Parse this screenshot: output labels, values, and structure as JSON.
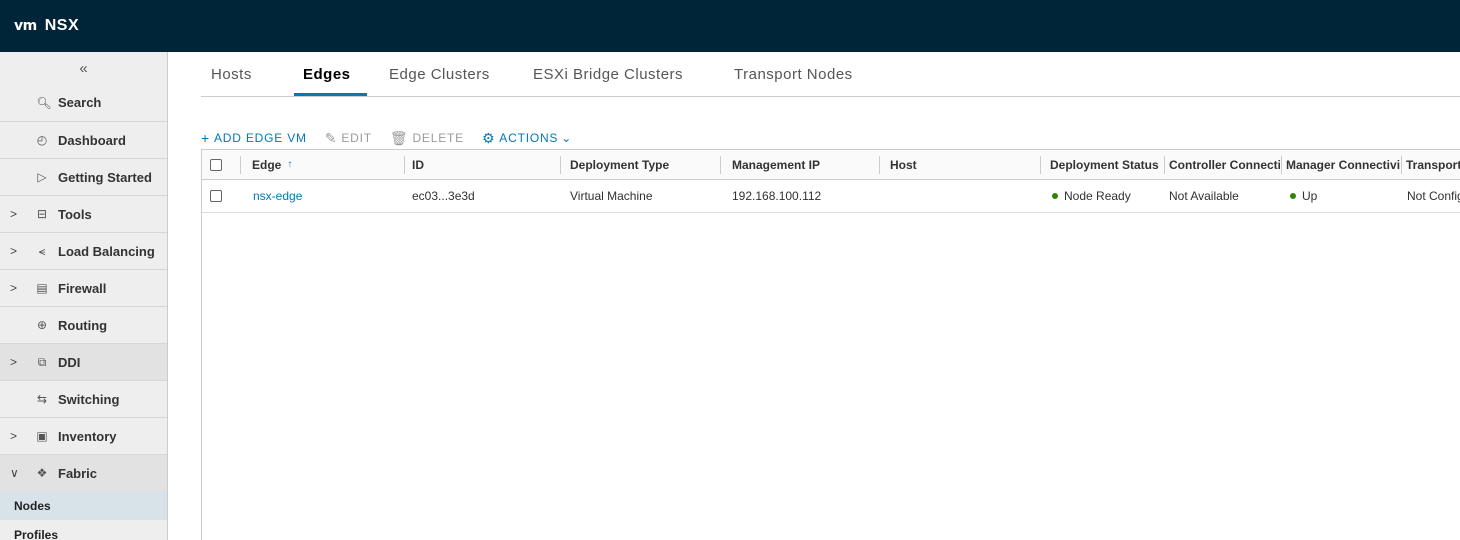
{
  "app": {
    "logo_mark": "vm",
    "title": "NSX"
  },
  "sidebar": {
    "collapse_glyph": "«",
    "items": [
      {
        "label": "Search",
        "icon": "search-icon",
        "glyph": "🔍︎",
        "expandable": false
      },
      {
        "label": "Dashboard",
        "icon": "dashboard-icon",
        "glyph": "◴",
        "expandable": false
      },
      {
        "label": "Getting Started",
        "icon": "play-icon",
        "glyph": "▷",
        "expandable": false
      },
      {
        "label": "Tools",
        "icon": "tools-icon",
        "glyph": "⊟",
        "expandable": true
      },
      {
        "label": "Load Balancing",
        "icon": "load-balancer-icon",
        "glyph": "⪪",
        "expandable": true
      },
      {
        "label": "Firewall",
        "icon": "firewall-icon",
        "glyph": "▤",
        "expandable": true
      },
      {
        "label": "Routing",
        "icon": "routing-icon",
        "glyph": "⊕",
        "expandable": false
      },
      {
        "label": "DDI",
        "icon": "ddi-icon",
        "glyph": "⧉",
        "expandable": true
      },
      {
        "label": "Switching",
        "icon": "switching-icon",
        "glyph": "⇆",
        "expandable": false
      },
      {
        "label": "Inventory",
        "icon": "inventory-icon",
        "glyph": "▣",
        "expandable": true
      },
      {
        "label": "Fabric",
        "icon": "fabric-icon",
        "glyph": "❖",
        "expandable": true,
        "expanded": true
      }
    ],
    "sub_items": [
      {
        "label": "Nodes",
        "active": true
      },
      {
        "label": "Profiles",
        "active": false
      }
    ],
    "chevron_right": ">",
    "chevron_down": "∨"
  },
  "tabs": [
    {
      "label": "Hosts",
      "active": false
    },
    {
      "label": "Edges",
      "active": true
    },
    {
      "label": "Edge Clusters",
      "active": false
    },
    {
      "label": "ESXi Bridge Clusters",
      "active": false
    },
    {
      "label": "Transport Nodes",
      "active": false
    }
  ],
  "toolbar": {
    "add": {
      "glyph": "+",
      "label": "ADD EDGE VM"
    },
    "edit": {
      "glyph": "✎",
      "label": "EDIT"
    },
    "delete": {
      "glyph": "🗑︎",
      "label": "DELETE"
    },
    "actions": {
      "glyph": "⚙",
      "label": "ACTIONS",
      "caret": "⌄"
    }
  },
  "table": {
    "columns": [
      "Edge",
      "ID",
      "Deployment Type",
      "Management IP",
      "Host",
      "Deployment Status",
      "Controller Connectivity",
      "Manager Connectivity",
      "Transport"
    ],
    "sort_glyph": "↑",
    "rows": [
      {
        "edge": "nsx-edge",
        "id": "ec03...3e3d",
        "deployment_type": "Virtual Machine",
        "management_ip": "192.168.100.112",
        "host": "",
        "deployment_status": "Node Ready",
        "controller_connectivity": "Not Available",
        "manager_connectivity": "Up",
        "transport": "Not Configured"
      }
    ]
  },
  "colors": {
    "header_bg": "#002538",
    "accent": "#0079b8",
    "status_ok": "#2f8400"
  }
}
